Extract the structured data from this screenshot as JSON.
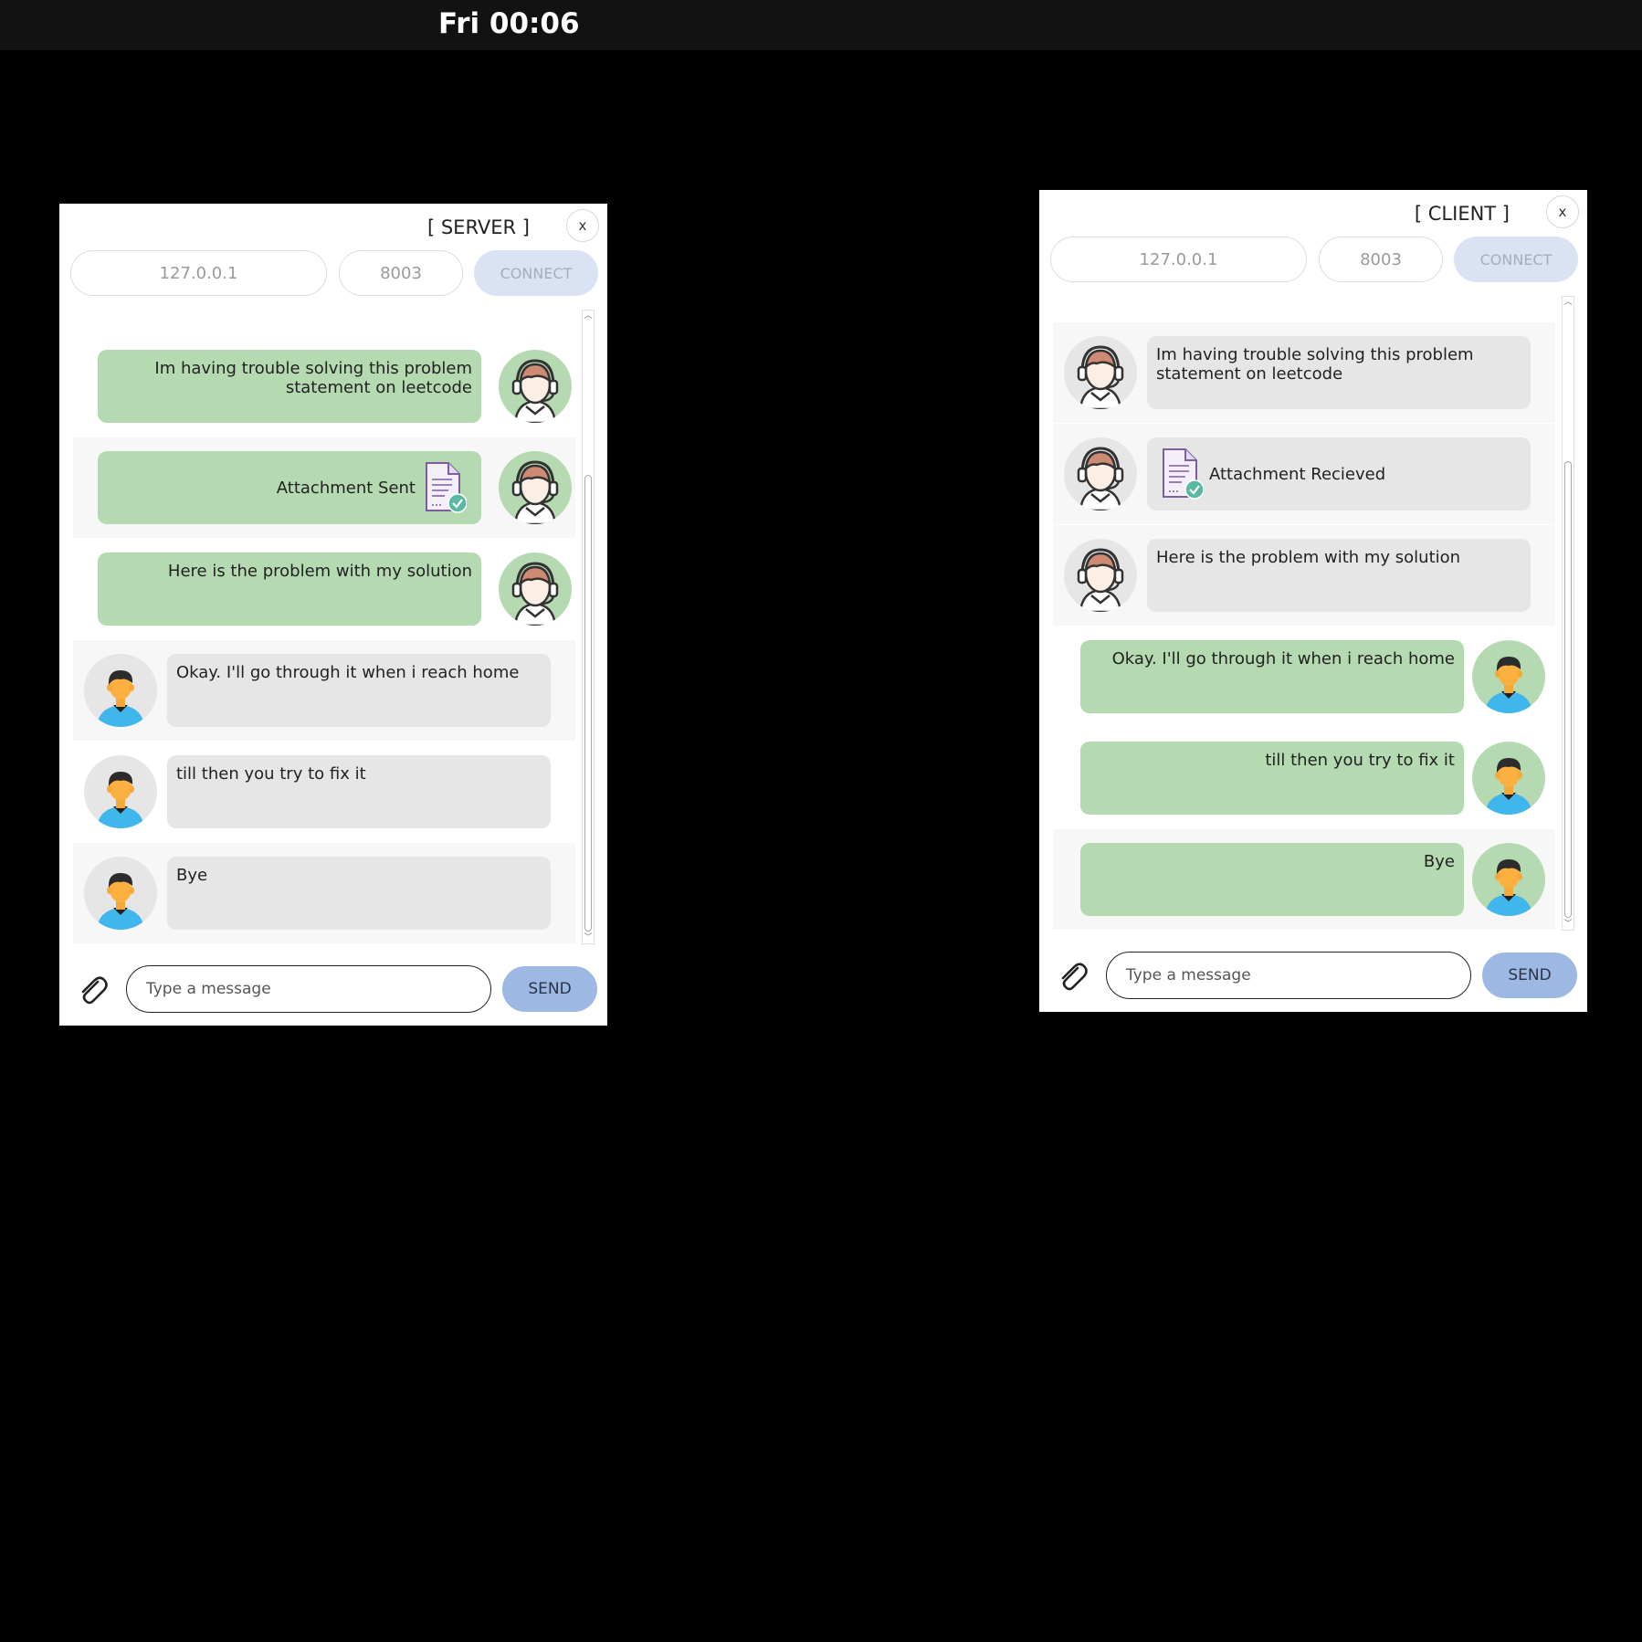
{
  "topbar": {
    "clock": "Fri 00:06"
  },
  "server": {
    "title": "[ SERVER ]",
    "close_label": "x",
    "ip_placeholder": "127.0.0.1",
    "port_placeholder": "8003",
    "connect_label": "CONNECT",
    "messages": [
      {
        "sender": "support",
        "text": "Im having trouble solving this problem statement on leetcode"
      },
      {
        "sender": "support",
        "text": "Attachment Sent",
        "attachment": true
      },
      {
        "sender": "support",
        "text": "Here is the problem with my solution"
      },
      {
        "sender": "user",
        "text": "Okay. I'll go through it when i reach home"
      },
      {
        "sender": "user",
        "text": "till then you try to fix it"
      },
      {
        "sender": "user",
        "text": "Bye"
      }
    ],
    "input_placeholder": "Type a message",
    "send_label": "SEND"
  },
  "client": {
    "title": "[ CLIENT ]",
    "close_label": "x",
    "ip_placeholder": "127.0.0.1",
    "port_placeholder": "8003",
    "connect_label": "CONNECT",
    "messages": [
      {
        "sender": "support",
        "text": "Im having trouble solving this problem statement on leetcode"
      },
      {
        "sender": "support",
        "text": "Attachment Recieved",
        "attachment": true
      },
      {
        "sender": "support",
        "text": "Here is the problem with my solution"
      },
      {
        "sender": "user",
        "text": "Okay. I'll go through it when i reach home"
      },
      {
        "sender": "user",
        "text": "till then you try to fix it"
      },
      {
        "sender": "user",
        "text": "Bye"
      }
    ],
    "input_placeholder": "Type a message",
    "send_label": "SEND"
  },
  "icons": {
    "support_avatar": "headset-agent-icon",
    "user_avatar": "user-person-icon",
    "attachment": "document-check-icon",
    "attach_button": "paperclip-icon"
  },
  "colors": {
    "self_bubble": "#b5d9b0",
    "other_bubble": "#e6e6e6",
    "send_button": "#9db9e3",
    "connect_button": "#dae3f3"
  }
}
